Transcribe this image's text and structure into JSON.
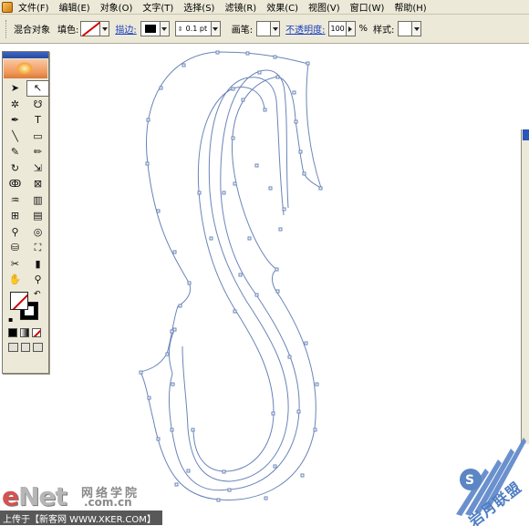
{
  "menubar": {
    "items": [
      "文件(F)",
      "编辑(E)",
      "对象(O)",
      "文字(T)",
      "选择(S)",
      "滤镜(R)",
      "效果(C)",
      "视图(V)",
      "窗口(W)",
      "帮助(H)"
    ]
  },
  "controlbar": {
    "selection_label": "混合对象",
    "fill_label": "填色:",
    "stroke_link": "描边:",
    "stroke_weight": "0.1 pt",
    "brush_label": "画笔:",
    "opacity_link": "不透明度:",
    "opacity_value": "100",
    "percent": "%",
    "style_label": "样式:"
  },
  "toolbox": {
    "tools": [
      {
        "icon": "selection-arrow-icon",
        "glyph": "➤"
      },
      {
        "icon": "direct-selection-icon",
        "glyph": "↖"
      },
      {
        "icon": "magic-wand-icon",
        "glyph": "✲"
      },
      {
        "icon": "lasso-icon",
        "glyph": "☋"
      },
      {
        "icon": "pen-icon",
        "glyph": "✒"
      },
      {
        "icon": "type-icon",
        "glyph": "T"
      },
      {
        "icon": "line-segment-icon",
        "glyph": "╲"
      },
      {
        "icon": "rectangle-icon",
        "glyph": "▭"
      },
      {
        "icon": "paintbrush-icon",
        "glyph": "✎"
      },
      {
        "icon": "pencil-icon",
        "glyph": "✏"
      },
      {
        "icon": "rotate-icon",
        "glyph": "↻"
      },
      {
        "icon": "scale-icon",
        "glyph": "⇲"
      },
      {
        "icon": "warp-icon",
        "glyph": "ↂ"
      },
      {
        "icon": "free-transform-icon",
        "glyph": "⊠"
      },
      {
        "icon": "symbol-sprayer-icon",
        "glyph": "♒"
      },
      {
        "icon": "graph-icon",
        "glyph": "▥"
      },
      {
        "icon": "mesh-icon",
        "glyph": "⊞"
      },
      {
        "icon": "gradient-icon",
        "glyph": "▤"
      },
      {
        "icon": "eyedropper-icon",
        "glyph": "⚲"
      },
      {
        "icon": "blend-icon",
        "glyph": "◎"
      },
      {
        "icon": "live-paint-bucket-icon",
        "glyph": "⛁"
      },
      {
        "icon": "live-paint-selection-icon",
        "glyph": "⛶"
      },
      {
        "icon": "scissors-icon",
        "glyph": "✂"
      },
      {
        "icon": "eraser-icon",
        "glyph": "▮"
      },
      {
        "icon": "hand-icon",
        "glyph": "✋"
      },
      {
        "icon": "zoom-icon",
        "glyph": "⚲"
      }
    ]
  },
  "watermark": {
    "enet_e": "e",
    "enet_rest": "Net",
    "cn_site": "网络学院",
    "domain": ".com.cn",
    "upload": "上传于【新客网 WWW.XKER.COM】",
    "wing_text": "岩月联盟"
  },
  "colors": {
    "path_stroke": "#6a84b8",
    "anchor": "#6a84b8",
    "ui_face": "#ece9d8",
    "link": "#1a3fbf"
  }
}
